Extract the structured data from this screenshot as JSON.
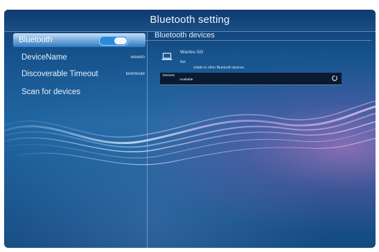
{
  "header": {
    "title": "Bluetooth setting"
  },
  "sidebar": {
    "items": [
      {
        "label": "Bluetooth",
        "toggle_on": true
      },
      {
        "label": "DeviceName",
        "value": "wowoto"
      },
      {
        "label": "Discoverable Timeout",
        "value": "twominute"
      },
      {
        "label": "Scan for devices"
      }
    ]
  },
  "main": {
    "section_title": "Bluetooth devices",
    "device": {
      "icon": "laptop-icon",
      "name": "Wanbo-5G",
      "state": "Not",
      "visibility_note": "visible to other Bluetooth devices"
    },
    "devices_bar": {
      "label": "Devices",
      "sublabel": "Available",
      "icon": "refresh-icon"
    }
  },
  "colors": {
    "background": "#1a5a92",
    "accent": "#2a8bdc",
    "selected_row": "#7fb1df",
    "devices_bar": "#0a1a33"
  }
}
